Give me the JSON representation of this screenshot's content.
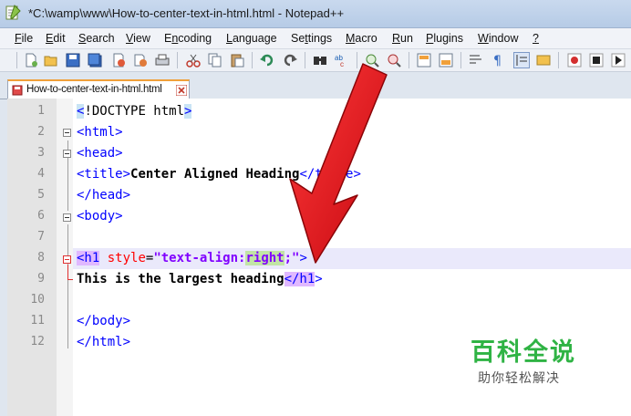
{
  "window": {
    "title": "*C:\\wamp\\www\\How-to-center-text-in-html.html - Notepad++"
  },
  "menu": [
    {
      "label": "File",
      "u": "F",
      "rest": "ile"
    },
    {
      "label": "Edit",
      "u": "E",
      "rest": "dit"
    },
    {
      "label": "Search",
      "u": "S",
      "rest": "earch"
    },
    {
      "label": "View",
      "u": "V",
      "rest": "iew"
    },
    {
      "label": "Encoding",
      "u": "n",
      "pre": "E",
      "rest": "coding"
    },
    {
      "label": "Language",
      "u": "L",
      "rest": "anguage"
    },
    {
      "label": "Settings",
      "u": "t",
      "pre": "Se",
      "rest": "tings"
    },
    {
      "label": "Macro",
      "u": "M",
      "rest": "acro"
    },
    {
      "label": "Run",
      "u": "R",
      "rest": "un"
    },
    {
      "label": "Plugins",
      "u": "P",
      "rest": "lugins"
    },
    {
      "label": "Window",
      "u": "W",
      "rest": "indow"
    },
    {
      "label": "?",
      "u": "?",
      "rest": ""
    }
  ],
  "tab": {
    "filename": "How-to-center-text-in-html.html"
  },
  "lines": [
    {
      "n": "1"
    },
    {
      "n": "2"
    },
    {
      "n": "3"
    },
    {
      "n": "4"
    },
    {
      "n": "5"
    },
    {
      "n": "6"
    },
    {
      "n": "7"
    },
    {
      "n": "8"
    },
    {
      "n": "9"
    },
    {
      "n": "10"
    },
    {
      "n": "11"
    },
    {
      "n": "12"
    }
  ],
  "code": {
    "l1_open": "<",
    "l1_text": "!DOCTYPE html",
    "l1_close": ">",
    "l2": "<html>",
    "l3": "<head>",
    "l4_open": "<title>",
    "l4_text": "Center Aligned Heading",
    "l4_close": "</title>",
    "l5": "</head>",
    "l6": "<body>",
    "l8_open": "<h1",
    "l8_attr": " style",
    "l8_eq": "=",
    "l8_str_a": "\"text-align:",
    "l8_str_sel": "right",
    "l8_str_b": ";\"",
    "l8_close": ">",
    "l9_text": "This is the largest heading",
    "l9_tag": "</h1",
    "l9_close": ">",
    "l11": "</body>",
    "l12": "</html>"
  },
  "watermark": {
    "brand": "百科全说",
    "tagline": "助你轻松解决"
  },
  "colors": {
    "tag": "#0000ff",
    "attribute": "#ff0000",
    "string": "#8000ff",
    "arrow": "#e8141c",
    "watermark": "#2fb344"
  }
}
